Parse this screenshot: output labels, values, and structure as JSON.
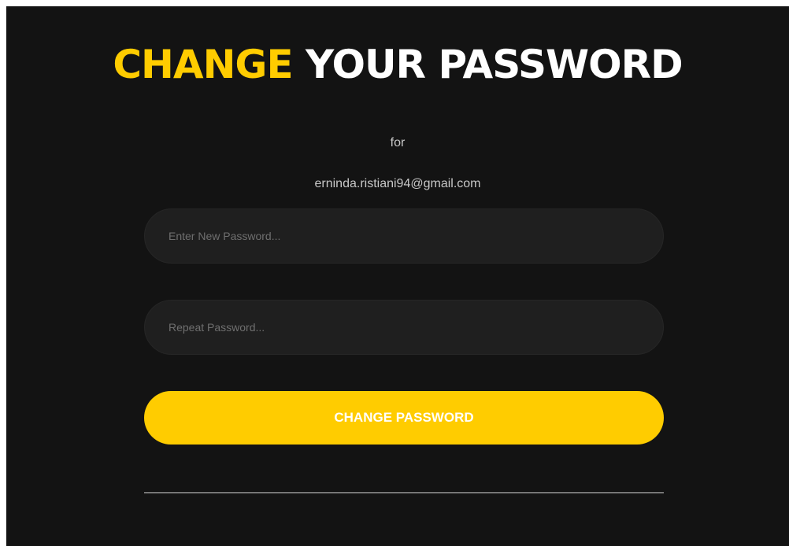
{
  "title": {
    "accent": "CHANGE",
    "rest": "YOUR PASSWORD"
  },
  "subtitle": "for",
  "email": "erninda.ristiani94@gmail.com",
  "form": {
    "new_password_placeholder": "Enter New Password...",
    "new_password_value": "",
    "repeat_password_placeholder": "Repeat Password...",
    "repeat_password_value": "",
    "submit_label": "CHANGE PASSWORD"
  },
  "colors": {
    "background": "#131313",
    "accent": "#ffcc00",
    "input_background": "#1f1f1f",
    "text_muted": "#c8c8c8"
  }
}
